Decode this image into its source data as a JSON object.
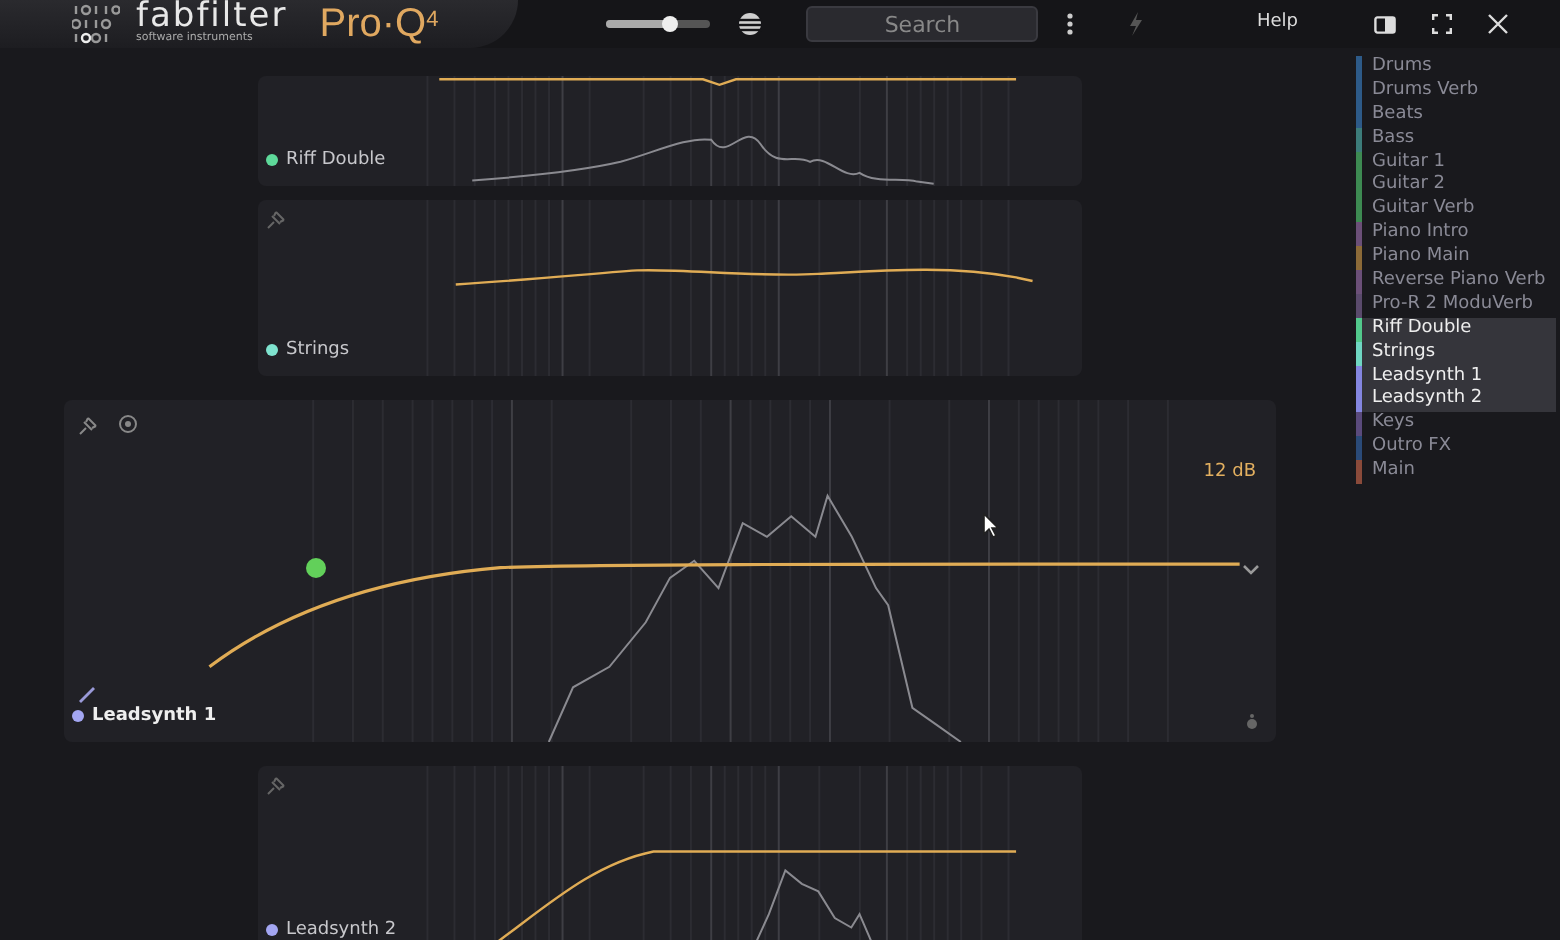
{
  "header": {
    "brand": "fabfilter",
    "tagline": "software instruments",
    "product": "Pro·Q$^{4}$",
    "output_slider": {
      "level": 0.62
    },
    "search": {
      "placeholder": "Search"
    },
    "help": "Help"
  },
  "panels": [
    {
      "name": "Riff Double",
      "color": "#5ed99a",
      "expanded": false,
      "kind": "notch"
    },
    {
      "name": "Strings",
      "color": "#7fe3cf",
      "expanded": false,
      "kind": "tilt"
    },
    {
      "name": "Leadsynth 1",
      "color": "#a3a6f2",
      "expanded": true,
      "kind": "low-cut",
      "gain_label": "12 dB"
    },
    {
      "name": "Leadsynth 2",
      "color": "#a3a6f2",
      "expanded": false,
      "kind": "low-cut-steep"
    }
  ],
  "tracks": [
    {
      "name": "Drums",
      "color": "#2d5a88",
      "selected": false
    },
    {
      "name": "Drums Verb",
      "color": "#2d5a88",
      "selected": false
    },
    {
      "name": "Beats",
      "color": "#2d5a88",
      "selected": false
    },
    {
      "name": "Bass",
      "color": "#3c7c7a",
      "selected": false
    },
    {
      "name": "Guitar 1",
      "color": "#3d8a52",
      "selected": false
    },
    {
      "name": "Guitar 2",
      "color": "#3d8a52",
      "selected": false
    },
    {
      "name": "Guitar Verb",
      "color": "#3d8a52",
      "selected": false
    },
    {
      "name": "Piano Intro",
      "color": "#6b4f78",
      "selected": false
    },
    {
      "name": "Piano Main",
      "color": "#8c6a38",
      "selected": false
    },
    {
      "name": "Reverse Piano Verb",
      "color": "#6b4f78",
      "selected": false
    },
    {
      "name": "Pro-R 2 ModuVerb",
      "color": "#5a4a6c",
      "selected": false
    },
    {
      "name": "Riff Double",
      "color": "#52c98c",
      "selected": true
    },
    {
      "name": "Strings",
      "color": "#6fd6c2",
      "selected": true
    },
    {
      "name": "Leadsynth 1",
      "color": "#8486e0",
      "selected": true
    },
    {
      "name": "Leadsynth 2",
      "color": "#8486e0",
      "selected": true
    },
    {
      "name": "Keys",
      "color": "#5a4a7c",
      "selected": false
    },
    {
      "name": "Outro FX",
      "color": "#2a4a78",
      "selected": false
    },
    {
      "name": "Main",
      "color": "#8a4a3a",
      "selected": false
    }
  ]
}
